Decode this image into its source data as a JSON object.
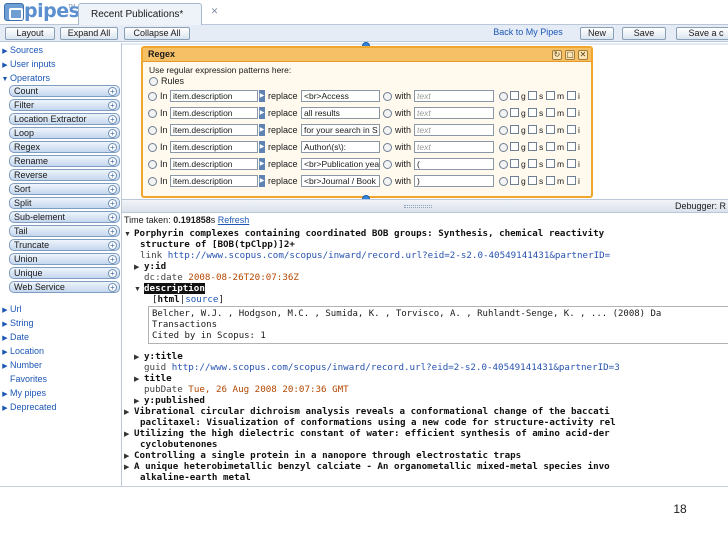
{
  "app": {
    "logo_text": "pipes",
    "logo_tm": "TM",
    "document_tab": "Recent Publications*"
  },
  "toolbar": {
    "layout": "Layout",
    "expand_all": "Expand All",
    "collapse_all": "Collapse All",
    "back": "Back to My Pipes",
    "new": "New",
    "save": "Save",
    "save_as": "Save a c"
  },
  "library": {
    "sources": "Sources",
    "user_inputs": "User inputs",
    "operators": "Operators",
    "operator_items": [
      "Count",
      "Filter",
      "Location Extractor",
      "Loop",
      "Regex",
      "Rename",
      "Reverse",
      "Sort",
      "Split",
      "Sub-element",
      "Tail",
      "Truncate",
      "Union",
      "Unique",
      "Web Service"
    ],
    "url": "Url",
    "string": "String",
    "date": "Date",
    "location": "Location",
    "number": "Number",
    "favorites": "Favorites",
    "my_pipes": "My pipes",
    "deprecated": "Deprecated"
  },
  "regex_module": {
    "title": "Regex",
    "hint": "Use regular expression patterns here:",
    "rules_label": "Rules",
    "in_label": "In",
    "replace_label": "replace",
    "with_label": "with",
    "flags": [
      "g",
      "s",
      "m",
      "i"
    ],
    "rules": [
      {
        "path": "item.description",
        "pattern": "<br>Access",
        "replacement": "",
        "placeholder": "text"
      },
      {
        "path": "item.description",
        "pattern": "all results",
        "replacement": "",
        "placeholder": "text"
      },
      {
        "path": "item.description",
        "pattern": "for your search in S",
        "replacement": "",
        "placeholder": "text"
      },
      {
        "path": "item.description",
        "pattern": "Author\\(s\\):",
        "replacement": "",
        "placeholder": "text"
      },
      {
        "path": "item.description",
        "pattern": "<br>Publication yea",
        "replacement": "(",
        "placeholder": ""
      },
      {
        "path": "item.description",
        "pattern": "<br>Journal / Book",
        "replacement": ")",
        "placeholder": ""
      }
    ]
  },
  "debugger": {
    "label": "Debugger: R",
    "time_label": "Time taken:",
    "time_value": "0.191858",
    "time_unit": "s",
    "refresh": "Refresh",
    "item1_title_a": "Porphyrin complexes containing coordinated BOB groups: Synthesis, chemical reactivity",
    "item1_title_b": "structure of [BOB(tpClpp)]2+",
    "item1_link_key": "link",
    "item1_link": "http://www.scopus.com/scopus/inward/record.url?eid=2-s2.0-40549141431&partnerID=",
    "item1_yid": "y:id",
    "item1_dcdate_key": "dc:date",
    "item1_dcdate": "2008-08-26T20:07:36Z",
    "item1_description": "description",
    "html_tab": "html",
    "source_tab": "source",
    "desc_line1": "Belcher, W.J. , Hodgson, M.C. , Sumida, K. , Torvisco, A. , Ruhlandt-Senge, K. , ... (2008) Da",
    "desc_line2": "Transactions",
    "desc_line3": "Cited by in Scopus: 1",
    "ytitle": "y:title",
    "guid_key": "guid",
    "guid": "http://www.scopus.com/scopus/inward/record.url?eid=2-s2.0-40549141431&partnerID=3",
    "title_key": "title",
    "pubdate_key": "pubDate",
    "pubdate": "Tue, 26 Aug 2008 20:07:36 GMT",
    "ypublished": "y:published",
    "item2": "Vibrational circular dichroism analysis reveals a conformational change of the baccati",
    "item3": "paclitaxel: Visualization of conformations using a new code for structure-activity rel",
    "item4a": "Utilizing the high dielectric constant of water: efficient synthesis of amino acid-der",
    "item4b": "cyclobutenones",
    "item5": "Controlling a single protein in a nanopore through electrostatic traps",
    "item6a": "A unique heterobimetallic benzyl calciate - An organometallic mixed-metal species invo",
    "item6b": "alkaline-earth metal"
  },
  "page_number": "18",
  "colors": {
    "accent": "#1d57b5",
    "module_border": "#f0a62d",
    "connector": "#2f86e0"
  }
}
